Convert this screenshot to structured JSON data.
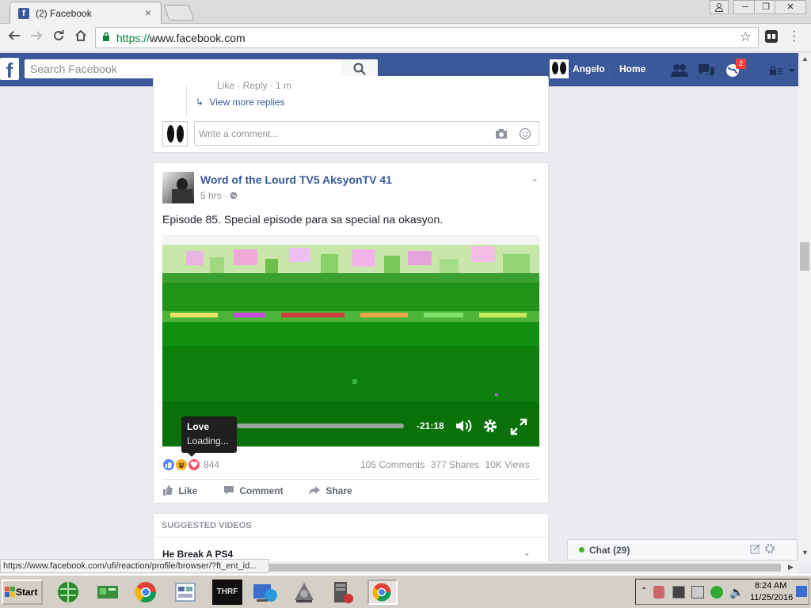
{
  "browser": {
    "tab_title": "(2) Facebook",
    "tab_close": "×",
    "url_scheme": "https://",
    "url_rest": "www.facebook.com",
    "win_buttons": [
      "─",
      "❐",
      "✕"
    ]
  },
  "facebook": {
    "logo": "f",
    "search_placeholder": "Search Facebook",
    "user_name": "Angelo",
    "home_label": "Home",
    "notification_count": "2"
  },
  "previous_post": {
    "reply_actions": "Like · Reply · 1 m",
    "view_more_replies": "View more replies",
    "comment_placeholder": "Write a comment..."
  },
  "post": {
    "author": "Word of the Lourd TV5 AksyonTV 41",
    "time": "5 hrs ·",
    "text": "Episode 85. Special episode para sa special na okasyon.",
    "video_time": "-21:18",
    "video_progress_pct": 0,
    "tooltip_title": "Love",
    "tooltip_sub": "Loading...",
    "reaction_count": "844",
    "comments": "105 Comments",
    "shares": "377 Shares",
    "views": "10K Views",
    "like_label": "Like",
    "comment_label": "Comment",
    "share_label": "Share"
  },
  "suggested": {
    "header": "SUGGESTED VIDEOS",
    "first_title": "He Break A PS4"
  },
  "chat": {
    "label": "Chat (29)"
  },
  "status_url": "https://www.facebook.com/ufi/reaction/profile/browser/?ft_ent_id...",
  "taskbar": {
    "start": "Start",
    "time": "8:24 AM",
    "date": "11/25/2016",
    "app_label": "THRF"
  },
  "colors": {
    "facebook_blue": "#3b5998",
    "link_blue": "#365899",
    "chat_online": "#42b72a",
    "badge_red": "#fa3e3e"
  }
}
